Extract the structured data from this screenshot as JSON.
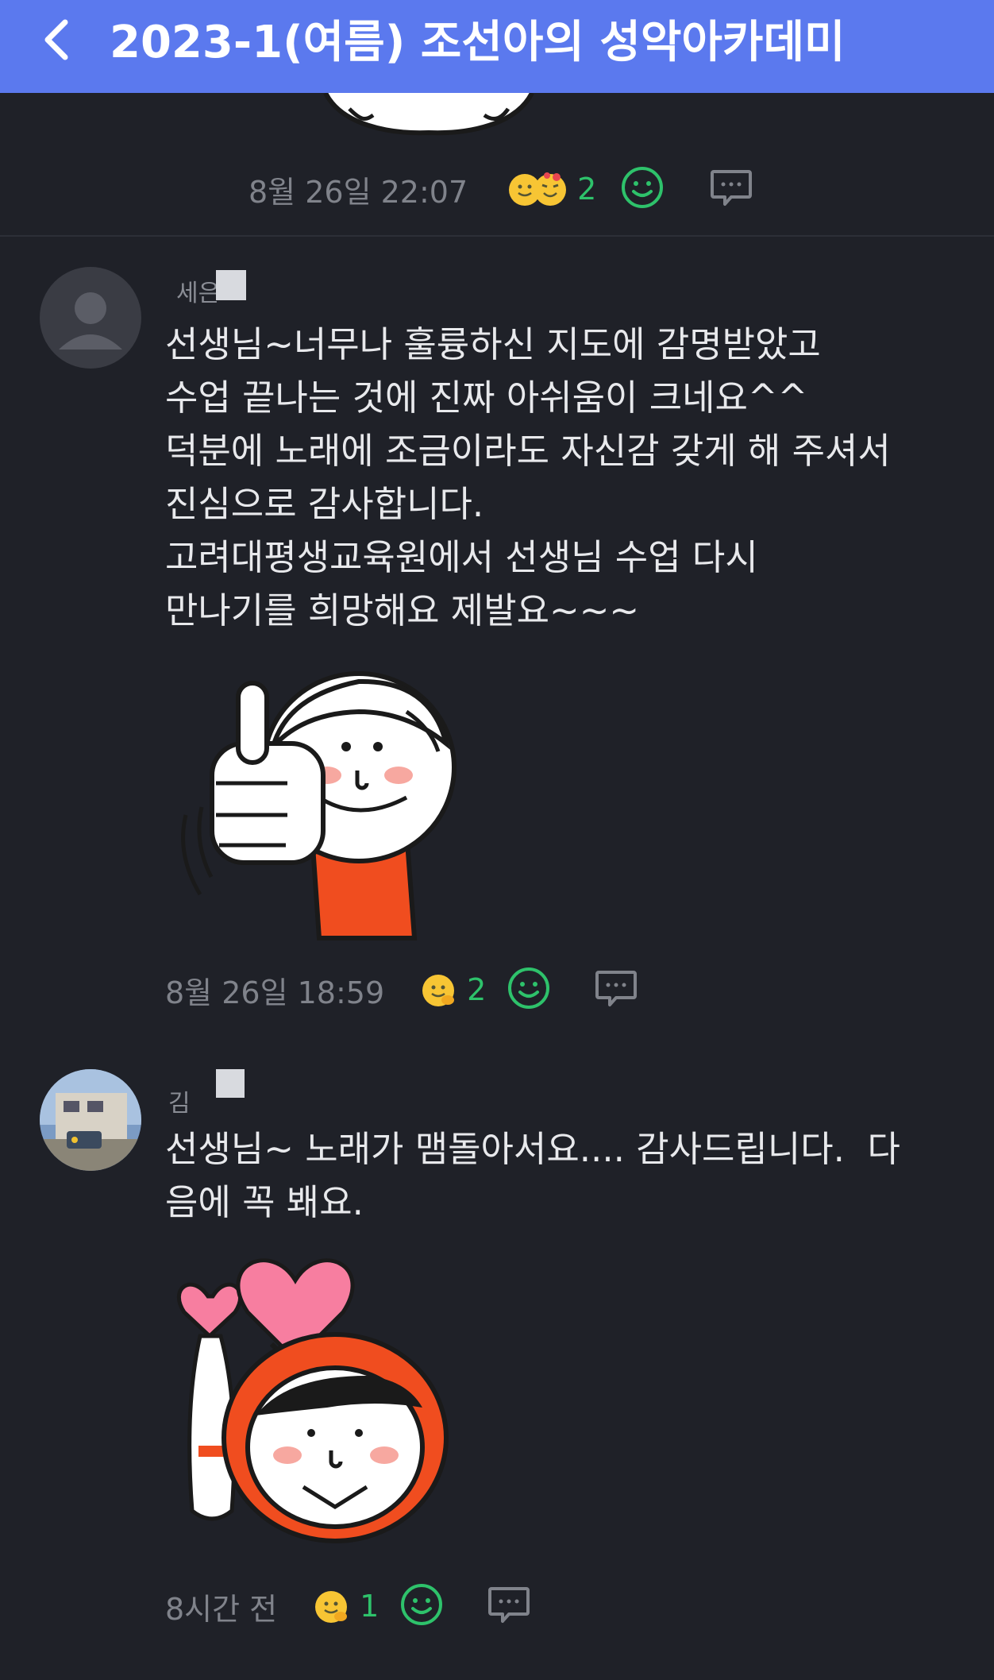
{
  "header": {
    "title": "2023-1(여름) 조선아의 성악아카데미",
    "accent_color": "#5b79ee"
  },
  "top_post": {
    "timestamp": "8월 26일 22:07",
    "reaction_count": "2"
  },
  "comments": [
    {
      "author_initial": "세은",
      "lines": [
        "선생님~너무나 훌륭하신 지도에 감명받았고",
        "수업 끝나는 것에 진짜 아쉬움이 크네요^^",
        "덕분에 노래에 조금이라도 자신감 갖게 해 주셔서",
        "진심으로 감사합니다.",
        "고려대평생교육원에서 선생님 수업 다시",
        "만나기를 희망해요 제발요~~~"
      ],
      "sticker": "thumbs-up-sticker",
      "timestamp": "8월 26일 18:59",
      "reaction_count": "2"
    },
    {
      "author_initial": "김",
      "lines": [
        "선생님~ 노래가 맴돌아서요.... 감사드립니다.  다",
        "음에 꼭 봬요."
      ],
      "sticker": "heart-sticker",
      "timestamp": "8시간 전",
      "reaction_count": "1"
    }
  ],
  "colors": {
    "background": "#1f2128",
    "reaction_green": "#2ec26b",
    "muted_text": "#80838b"
  }
}
